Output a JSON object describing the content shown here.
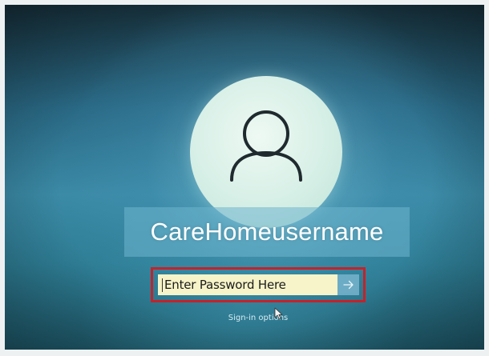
{
  "user": {
    "name": "CareHomeusername",
    "avatar_icon": "person-icon"
  },
  "password": {
    "placeholder": "Enter Password Here",
    "submit_icon": "arrow-right-icon"
  },
  "links": {
    "sign_in_options": "Sign-in options"
  },
  "colors": {
    "highlight_border": "#c4222a",
    "field_background": "#f6f4c8",
    "username_band": "#6eb4cd"
  }
}
